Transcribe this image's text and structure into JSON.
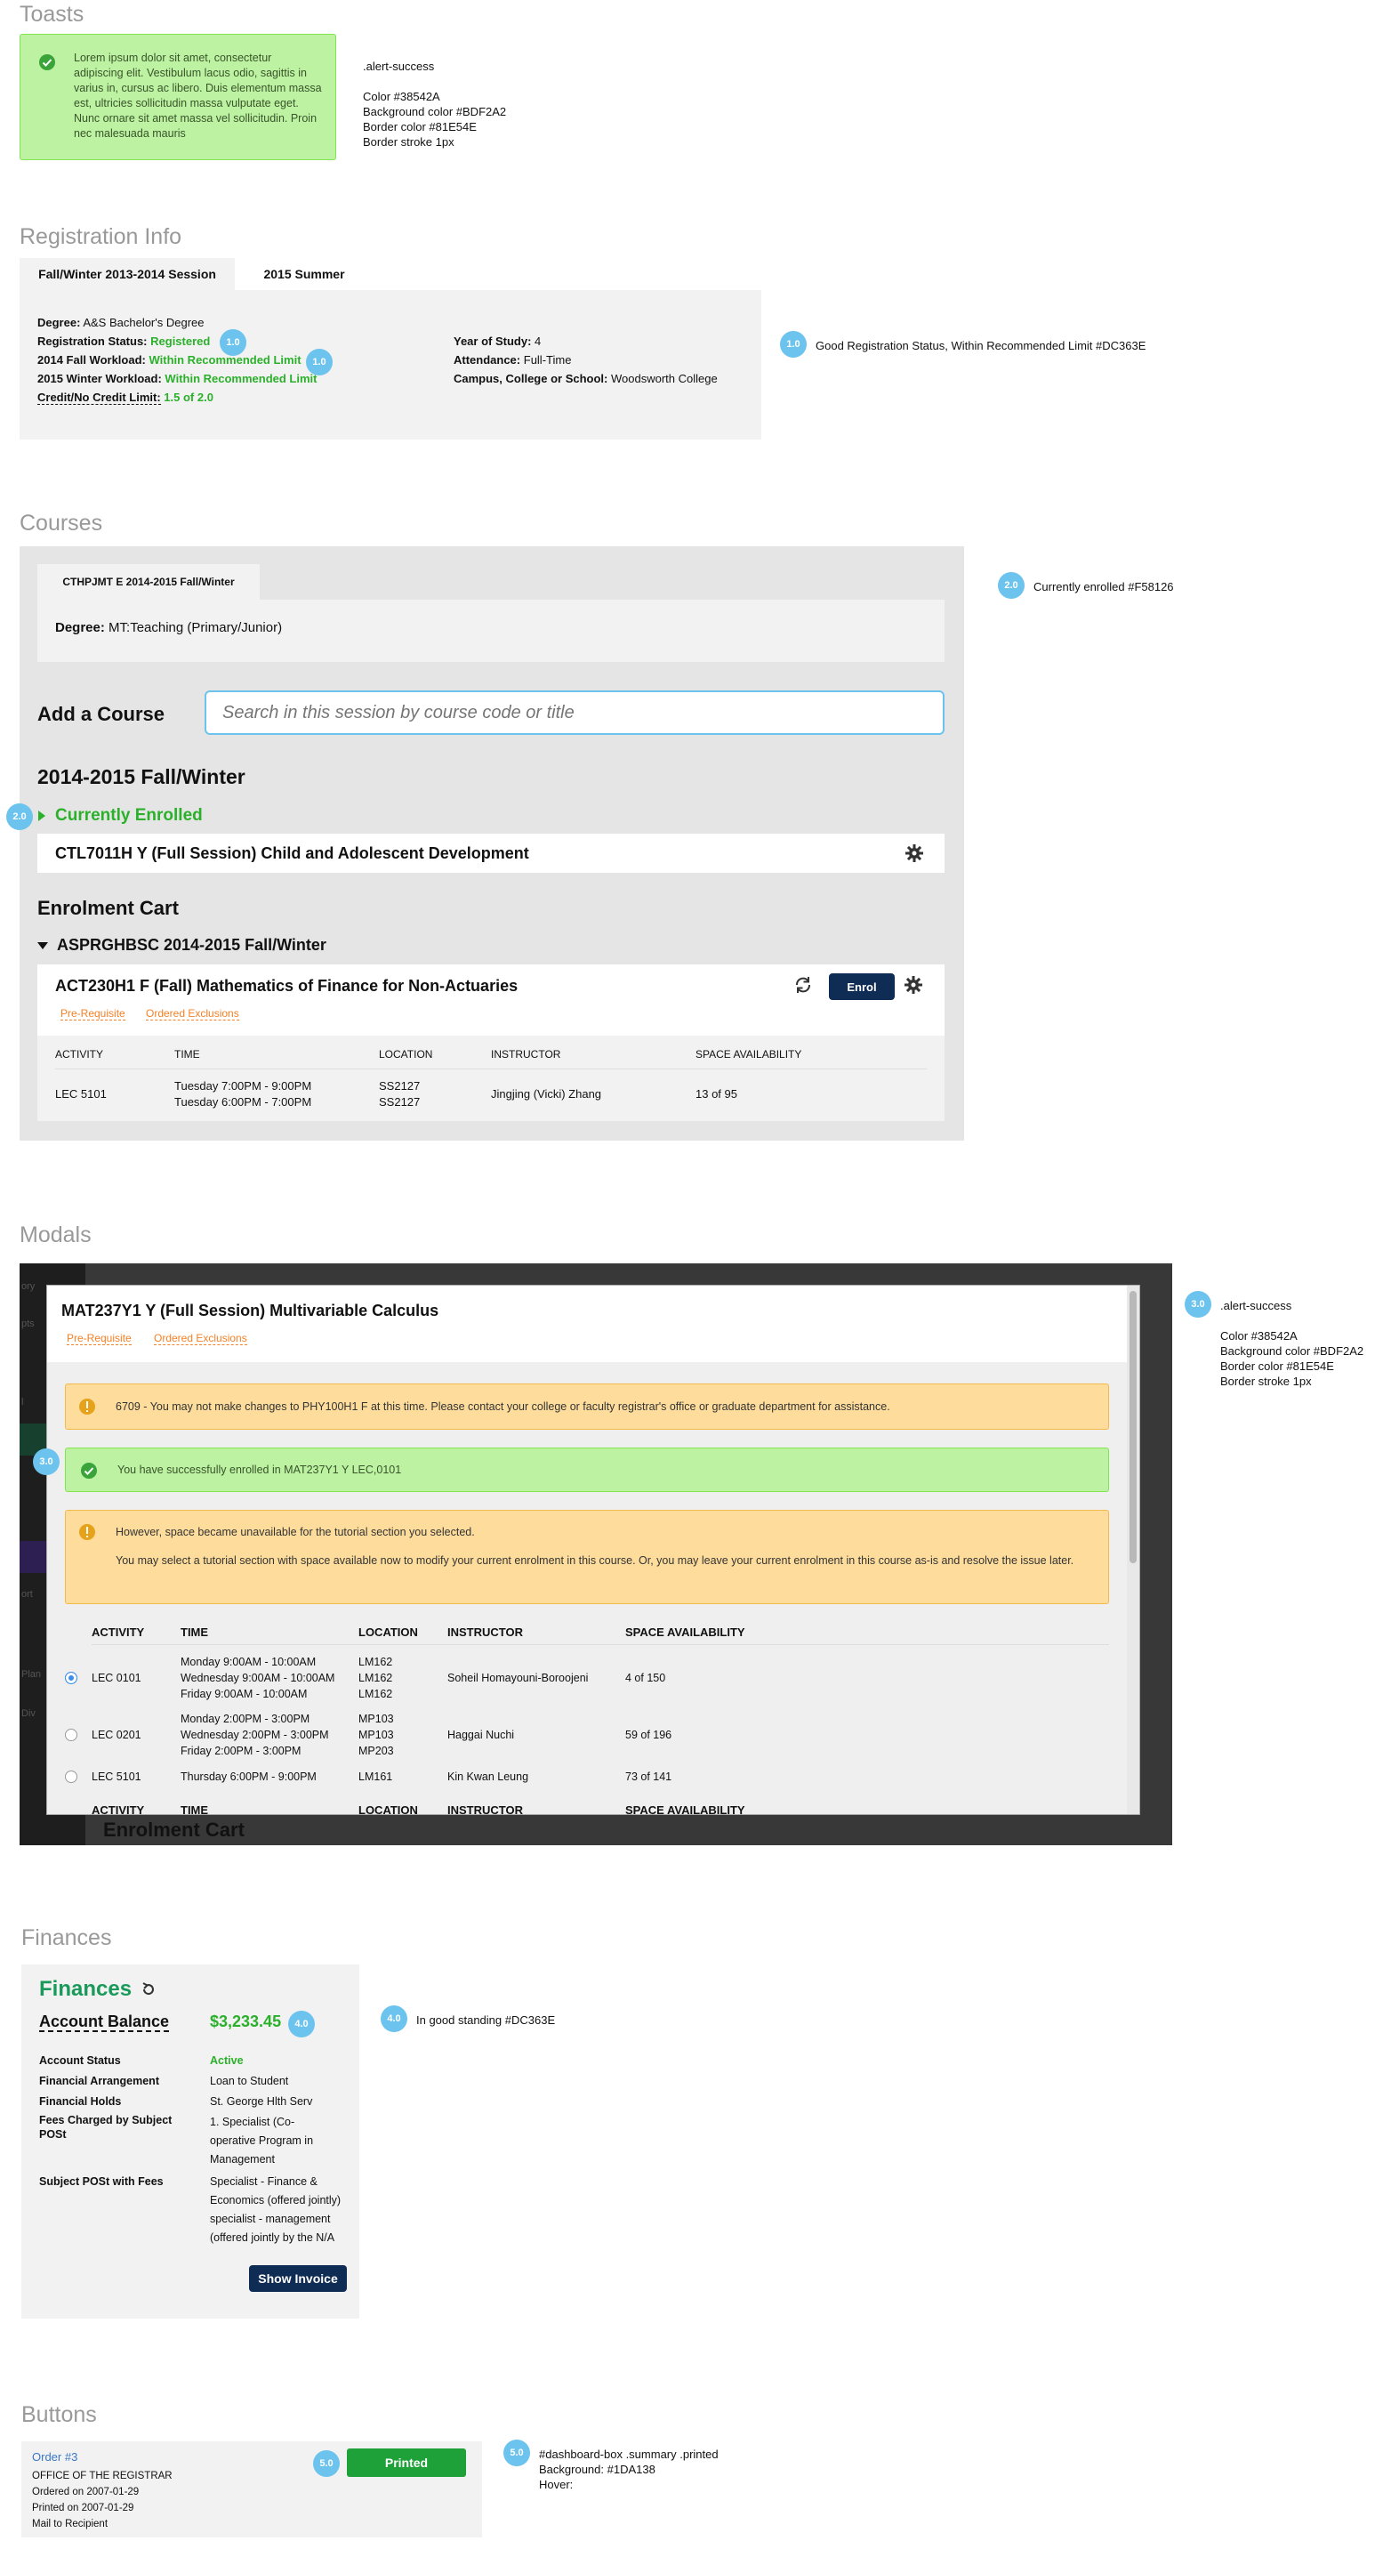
{
  "toasts": {
    "title": "Toasts",
    "message": "Lorem ipsum dolor sit amet, consectetur adipiscing elit. Vestibulum lacus odio, sagittis in varius in, cursus ac libero. Duis elementum massa est, ultricies sollicitudin massa vulputate eget. Nunc ornare sit amet massa vel sollicitudin. Proin nec malesuada mauris",
    "note_lines": [
      ".alert-success",
      "Color #38542A",
      "Background color #BDF2A2",
      "Border color #81E54E",
      "Border stroke 1px"
    ]
  },
  "registration": {
    "title": "Registration Info",
    "tabs": [
      "Fall/Winter 2013-2014 Session",
      "2015 Summer"
    ],
    "left": {
      "degree_label": "Degree:",
      "degree_value": "A&S Bachelor's Degree",
      "status_label": "Registration Status:",
      "status_value": "Registered",
      "fall_label": "2014 Fall Workload:",
      "fall_value": "Within Recommended Limit",
      "winter_label": "2015 Winter Workload:",
      "winter_value": "Within Recommended Limit",
      "credit_label": "Credit/No Credit Limit:",
      "credit_value": "1.5 of 2.0"
    },
    "right": {
      "year_label": "Year of Study:",
      "year_value": "4",
      "attendance_label": "Attendance:",
      "attendance_value": "Full-Time",
      "campus_label": "Campus, College or School:",
      "campus_value": "Woodsworth College"
    },
    "badge": "1.0",
    "note": "Good Registration Status, Within Recommended Limit #DC363E"
  },
  "courses": {
    "title": "Courses",
    "tab": "CTHPJMT E 2014-2015 Fall/Winter",
    "degree_label": "Degree:",
    "degree_value": "MT:Teaching (Primary/Junior)",
    "add_label": "Add a Course",
    "search_placeholder": "Search in this session by course code or title",
    "session_heading": "2014-2015 Fall/Winter",
    "enrolled_heading": "Currently Enrolled",
    "enrolled_course": "CTL7011H Y (Full Session) Child and Adolescent Development",
    "cart_heading": "Enrolment Cart",
    "cart_group": "ASPRGHBSC 2014-2015 Fall/Winter",
    "cart_course": "ACT230H1 F (Fall) Mathematics of Finance for Non-Actuaries",
    "enrol_button": "Enrol",
    "links": [
      "Pre-Requisite",
      "Ordered Exclusions"
    ],
    "table_headers": [
      "ACTIVITY",
      "TIME",
      "LOCATION",
      "INSTRUCTOR",
      "SPACE AVAILABILITY"
    ],
    "row": {
      "activity": "LEC 5101",
      "time1": "Tuesday 7:00PM - 9:00PM",
      "time2": "Tuesday 6:00PM - 7:00PM",
      "loc1": "SS2127",
      "loc2": "SS2127",
      "instructor": "Jingjing (Vicki) Zhang",
      "space": "13 of 95"
    },
    "badge": "2.0",
    "note": "Currently enrolled #F58126"
  },
  "modals": {
    "title": "Modals",
    "modal_title": "MAT237Y1 Y (Full Session) Multivariable Calculus",
    "links": [
      "Pre-Requisite",
      "Ordered Exclusions"
    ],
    "warning1": "6709 - You may not make changes to PHY100H1 F at this time. Please contact your college or faculty registrar's office or graduate department for assistance.",
    "success": "You have successfully enrolled in MAT237Y1 Y LEC,0101",
    "warning2_line1": "However, space became unavailable for the tutorial section you selected.",
    "warning2_line2": "You may select a tutorial section with space available now to modify your current enrolment in this course. Or, you may leave your current enrolment in this course as-is and resolve the issue later.",
    "table_headers": [
      "ACTIVITY",
      "TIME",
      "LOCATION",
      "INSTRUCTOR",
      "SPACE AVAILABILITY"
    ],
    "rows": [
      {
        "activity": "LEC 0101",
        "times": [
          "Monday 9:00AM - 10:00AM",
          "Wednesday 9:00AM - 10:00AM",
          "Friday 9:00AM - 10:00AM"
        ],
        "locs": [
          "LM162",
          "LM162",
          "LM162"
        ],
        "instructor": "Soheil Homayouni-Boroojeni",
        "space": "4 of 150",
        "selected": true
      },
      {
        "activity": "LEC 0201",
        "times": [
          "Monday 2:00PM - 3:00PM",
          "Wednesday 2:00PM - 3:00PM",
          "Friday 2:00PM - 3:00PM"
        ],
        "locs": [
          "MP103",
          "MP103",
          "MP203"
        ],
        "instructor": "Haggai Nuchi",
        "space": "59 of 196",
        "selected": false
      },
      {
        "activity": "LEC 5101",
        "times": [
          "Thursday 6:00PM - 9:00PM"
        ],
        "locs": [
          "LM161"
        ],
        "instructor": "Kin Kwan Leung",
        "space": "73 of 141",
        "selected": false
      }
    ],
    "backdrop_cart": "Enrolment Cart",
    "backdrop_fragments": [
      "ory",
      "pts",
      "l",
      "ort",
      "Plan",
      "Div"
    ],
    "badge": "3.0",
    "note_lines": [
      ".alert-success",
      "Color #38542A",
      "Background color #BDF2A2",
      "Border color #81E54E",
      "Border stroke 1px"
    ]
  },
  "finances": {
    "title": "Finances",
    "heading": "Finances",
    "balance_label": "Account Balance",
    "balance_value": "$3,233.45",
    "rows": [
      {
        "label": "Account Status",
        "value": "Active"
      },
      {
        "label": "Financial Arrangement",
        "value": "Loan to Student"
      },
      {
        "label": "Financial Holds",
        "value": "St. George Hlth Serv"
      },
      {
        "label": "Fees Charged by Subject POSt",
        "value": "1. Specialist (Co-operative Program in Management"
      },
      {
        "label": "Subject POSt with Fees",
        "value": "Specialist - Finance & Economics (offered jointly) specialist - management (offered jointly by the N/A"
      }
    ],
    "invoice_button": "Show Invoice",
    "badge": "4.0",
    "note": "In good standing #DC363E"
  },
  "buttons": {
    "title": "Buttons",
    "order_link": "Order #3",
    "lines": [
      "OFFICE OF THE REGISTRAR",
      "Ordered on 2007-01-29",
      "Printed on 2007-01-29",
      "Mail to Recipient"
    ],
    "printed_button": "Printed",
    "badge": "5.0",
    "note_lines": [
      "#dashboard-box .summary .printed",
      "Background: #1DA138",
      "Hover:"
    ]
  },
  "colors": {
    "success_bg": "#BDF2A2",
    "success_border": "#81E54E",
    "success_text": "#38542A",
    "good_green": "#2bb02b",
    "orange": "#F58126",
    "navy": "#0f2c55",
    "printed_green": "#1DA138",
    "badge_blue": "#6cc3ee"
  }
}
